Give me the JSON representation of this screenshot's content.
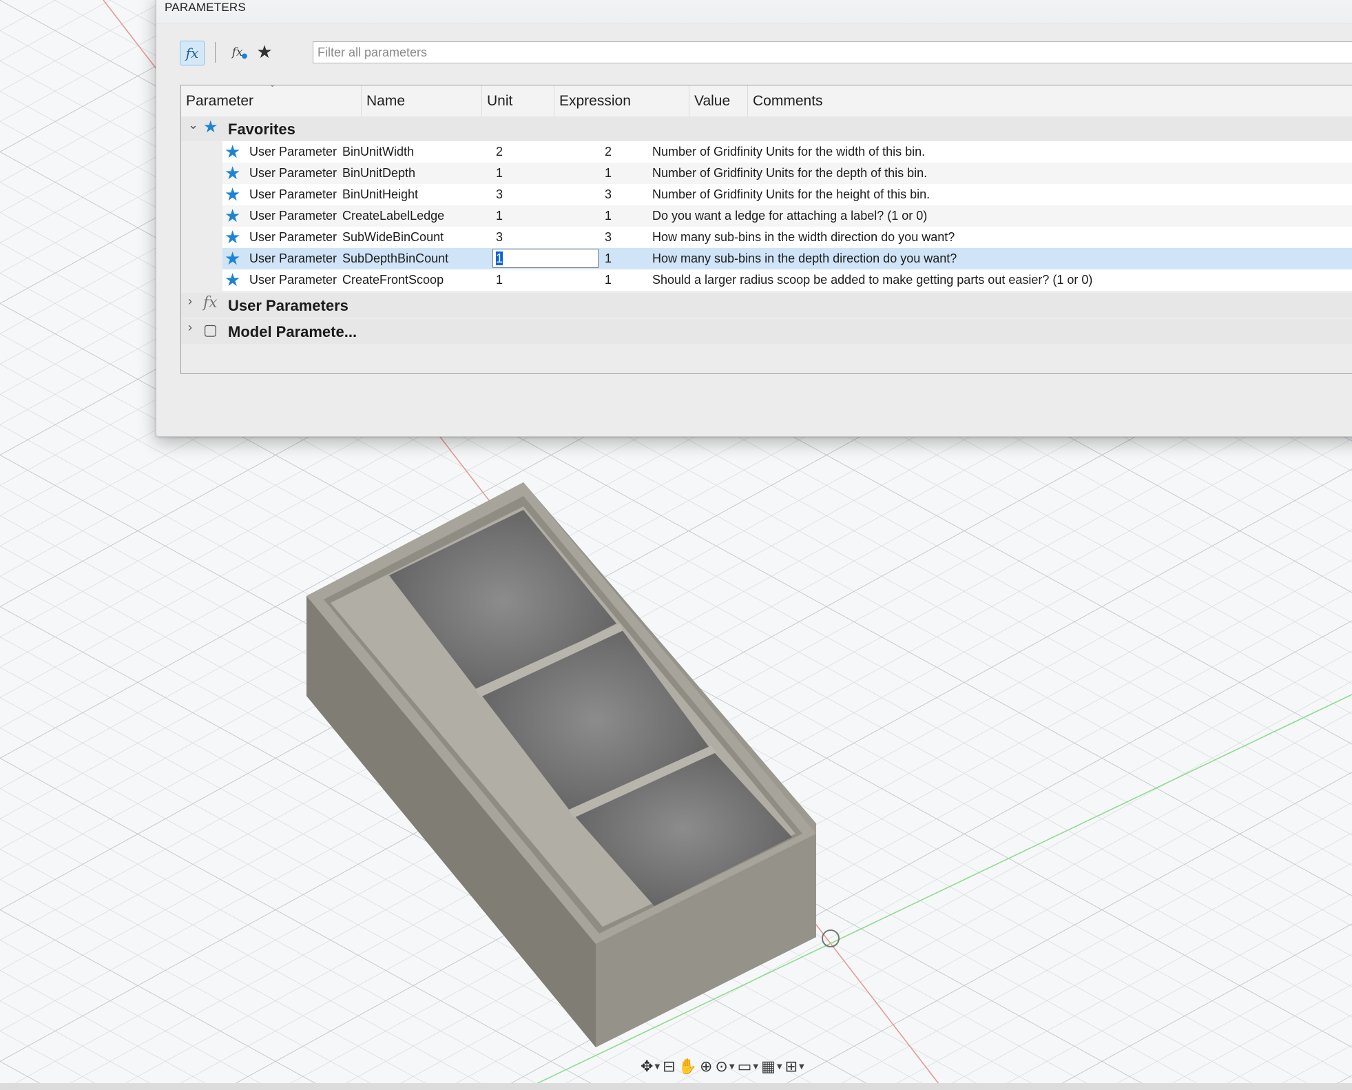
{
  "dialog": {
    "title": "PARAMETERS",
    "toolbar": {
      "filter_placeholder": "Filter all parameters",
      "fx_icon": "fx",
      "user_fx_icon": "fx-user-icon",
      "favorites_icon": "star-icon"
    },
    "table": {
      "columns": [
        "Parameter",
        "Name",
        "Unit",
        "Expression",
        "Value",
        "Comments"
      ],
      "groups": {
        "favorites": "Favorites",
        "user": "User Parameters",
        "model": "Model Paramete..."
      },
      "rows": [
        {
          "param": "User Parameter",
          "name": "BinUnitWidth",
          "unit": "",
          "expr": "2",
          "value": "2",
          "comment": "Number of Gridfinity Units for the width of this bin."
        },
        {
          "param": "User Parameter",
          "name": "BinUnitDepth",
          "unit": "",
          "expr": "1",
          "value": "1",
          "comment": "Number of Gridfinity Units for the depth of this bin."
        },
        {
          "param": "User Parameter",
          "name": "BinUnitHeight",
          "unit": "",
          "expr": "3",
          "value": "3",
          "comment": "Number of Gridfinity Units for the height of this bin."
        },
        {
          "param": "User Parameter",
          "name": "CreateLabelLedge",
          "unit": "",
          "expr": "1",
          "value": "1",
          "comment": "Do you want a ledge for attaching a label? (1 or 0)"
        },
        {
          "param": "User Parameter",
          "name": "SubWideBinCount",
          "unit": "",
          "expr": "3",
          "value": "3",
          "comment": "How many sub-bins in the width direction do you want?"
        },
        {
          "param": "User Parameter",
          "name": "SubDepthBinCount",
          "unit": "",
          "expr": "1",
          "value": "1",
          "comment": "How many sub-bins in the depth direction do you want?"
        },
        {
          "param": "User Parameter",
          "name": "CreateFrontScoop",
          "unit": "",
          "expr": "1",
          "value": "1",
          "comment": "Should a larger radius scoop be added to make getting parts out easier? (1 or 0)"
        }
      ]
    }
  },
  "colors": {
    "accent": "#1e84d2",
    "selection": "#cfe4f7",
    "model": "#9b978d"
  }
}
